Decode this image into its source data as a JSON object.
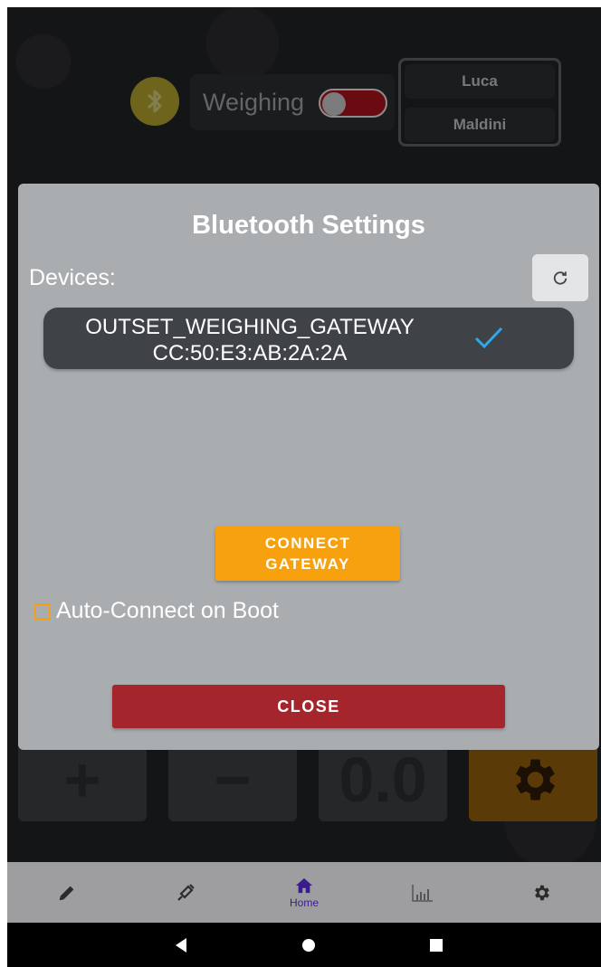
{
  "header": {
    "bluetooth_icon": "bluetooth-icon",
    "weighing_label": "Weighing",
    "weighing_toggle_on": false,
    "user_first_name": "Luca",
    "user_last_name": "Maldini"
  },
  "background_buttons": {
    "plus_label": "+",
    "minus_label": "−",
    "value_label": "0.0",
    "settings_icon": "gear-icon"
  },
  "dialog": {
    "title": "Bluetooth Settings",
    "devices_label": "Devices:",
    "refresh_icon": "refresh-icon",
    "devices": [
      {
        "name": "OUTSET_WEIGHING_GATEWAY",
        "mac": "CC:50:E3:AB:2A:2A",
        "selected": true
      }
    ],
    "connect_button_line1": "CONNECT",
    "connect_button_line2": "GATEWAY",
    "auto_connect_label": "Auto-Connect on Boot",
    "auto_connect_checked": false,
    "close_button": "CLOSE"
  },
  "bottom_nav": {
    "items": [
      {
        "icon": "pencil-icon",
        "label": ""
      },
      {
        "icon": "syringe-icon",
        "label": ""
      },
      {
        "icon": "home-icon",
        "label": "Home",
        "active": true
      },
      {
        "icon": "chart-icon",
        "label": ""
      },
      {
        "icon": "gear-icon",
        "label": ""
      }
    ]
  },
  "system_nav": [
    "back-icon",
    "home-circle-icon",
    "recents-icon"
  ],
  "colors": {
    "accent_orange": "#f6a10d",
    "close_red": "#a4262c",
    "check_blue": "#2fa8e8",
    "nav_active": "#3a1c8c"
  }
}
